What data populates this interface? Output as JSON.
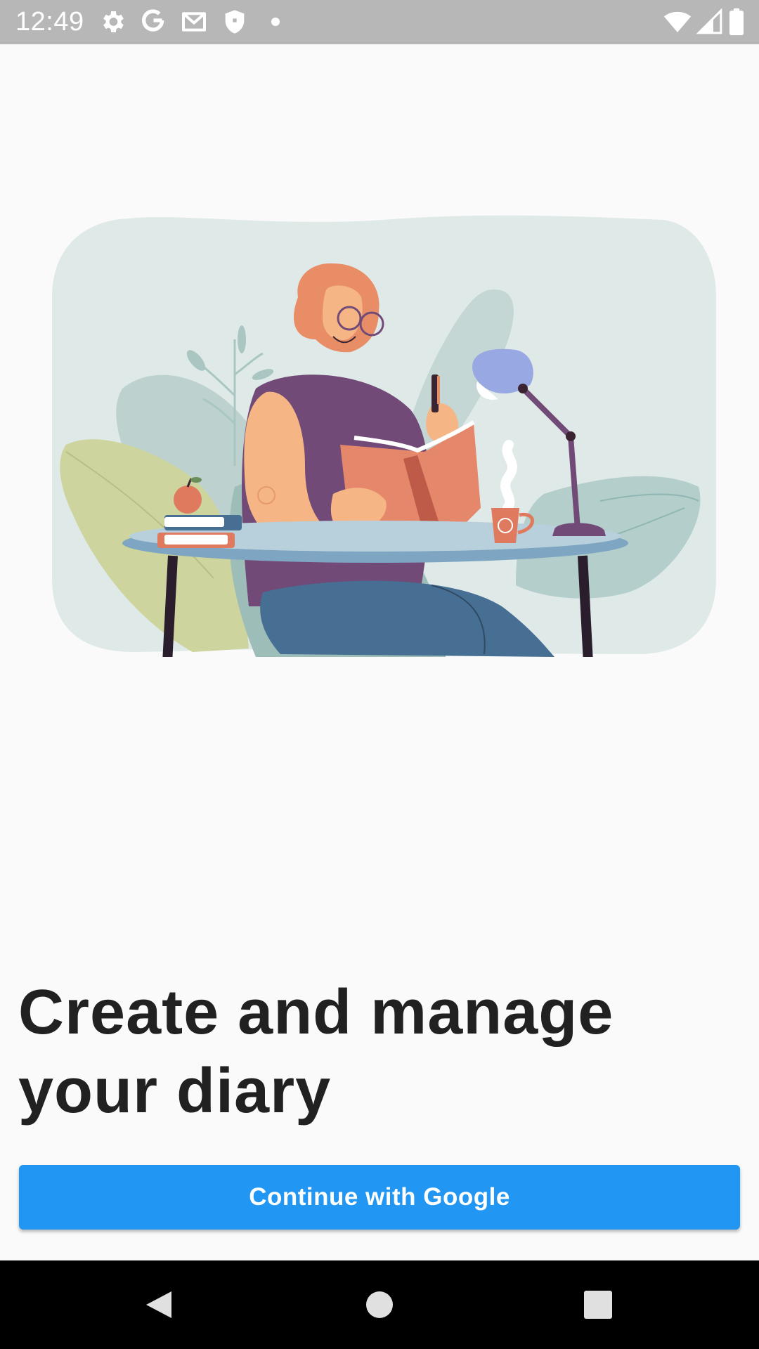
{
  "status_bar": {
    "time": "12:49",
    "left_icons": [
      "gear-icon",
      "google-g-icon",
      "gmail-icon",
      "shield-icon",
      "dot-icon"
    ],
    "right_icons": [
      "wifi-icon",
      "cellular-signal-icon",
      "battery-icon"
    ]
  },
  "hero": {
    "illustration": "person-writing-diary-illustration"
  },
  "headline": "Create and manage your diary",
  "google_button": {
    "label": "Continue with Google",
    "color": "#2196f3"
  },
  "nav_bar": {
    "buttons": [
      "back-icon",
      "home-icon",
      "recents-icon"
    ]
  },
  "colors": {
    "status_bar": "#b7b7b7",
    "background": "#fafafa",
    "headline": "#212121",
    "nav_bar": "#000000"
  }
}
